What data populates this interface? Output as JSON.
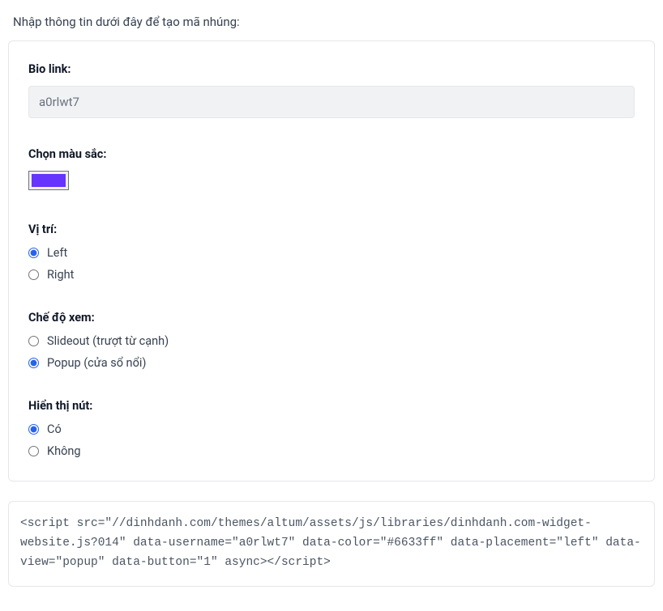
{
  "intro": "Nhập thông tin dưới đây để tạo mã nhúng:",
  "biolink": {
    "label": "Bio link:",
    "value": "a0rlwt7"
  },
  "color": {
    "label": "Chọn màu sắc:",
    "value": "#6633ff"
  },
  "position": {
    "label": "Vị trí:",
    "options": {
      "left": "Left",
      "right": "Right"
    },
    "selected": "left"
  },
  "viewmode": {
    "label": "Chế độ xem:",
    "options": {
      "slideout": "Slideout (trượt từ cạnh)",
      "popup": "Popup (cửa sổ nổi)"
    },
    "selected": "popup"
  },
  "showbutton": {
    "label": "Hiển thị nút:",
    "options": {
      "yes": "Có",
      "no": "Không"
    },
    "selected": "yes"
  },
  "embed_code": "<script src=\"//dinhdanh.com/themes/altum/assets/js/libraries/dinhdanh.com-widget-website.js?014\" data-username=\"a0rlwt7\" data-color=\"#6633ff\" data-placement=\"left\" data-view=\"popup\" data-button=\"1\" async></script>"
}
